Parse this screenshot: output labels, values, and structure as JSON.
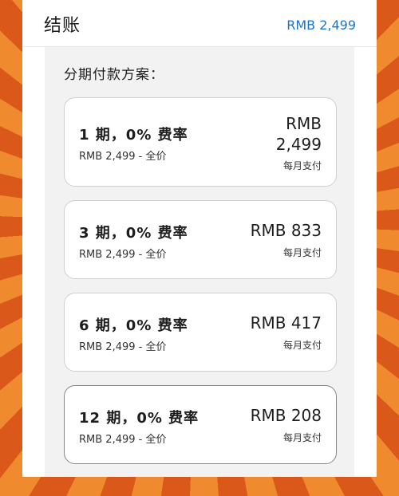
{
  "header": {
    "title": "结账",
    "amount": "RMB 2,499"
  },
  "section_label": "分期付款方案：",
  "options": [
    {
      "term": "1 期，0% 费率",
      "total": "RMB 2,499 - 全价",
      "price": "RMB 2,499",
      "per": "每月支付"
    },
    {
      "term": "3 期，0% 费率",
      "total": "RMB 2,499 - 全价",
      "price": "RMB 833",
      "per": "每月支付"
    },
    {
      "term": "6 期，0% 费率",
      "total": "RMB 2,499 - 全价",
      "price": "RMB 417",
      "per": "每月支付"
    },
    {
      "term": "12 期，0% 费率",
      "total": "RMB 2,499 - 全价",
      "price": "RMB 208",
      "per": "每月支付"
    }
  ],
  "selected_option": "12 期，0% 费率"
}
